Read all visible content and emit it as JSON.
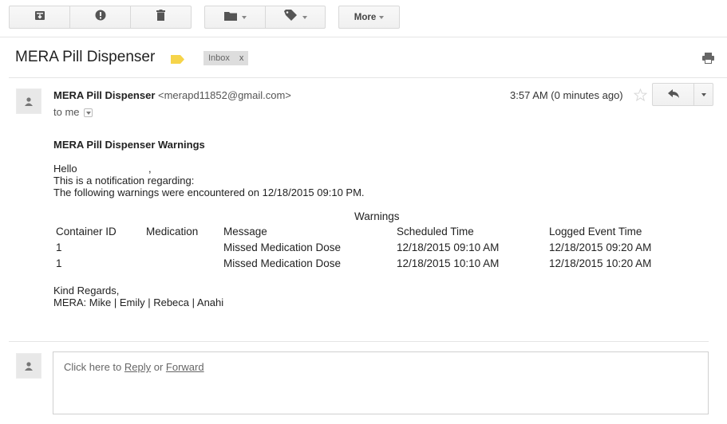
{
  "toolbar": {
    "more_label": "More",
    "icons": [
      "archive-icon",
      "spam-icon",
      "trash-icon",
      "folder-icon",
      "label-icon"
    ]
  },
  "subject": {
    "title": "MERA Pill Dispenser",
    "label_chip": "Inbox",
    "label_chip_close": "x"
  },
  "message": {
    "sender_name": "MERA Pill Dispenser",
    "sender_email": "<merapd11852@gmail.com>",
    "to_line": "to me",
    "time": "3:57 AM (0 minutes ago)",
    "heading": "MERA Pill Dispenser Warnings",
    "greeting": "Hello",
    "greeting_comma": ",",
    "line1": "This is a notification regarding:",
    "line2": "The following warnings were encountered on 12/18/2015 09:10 PM.",
    "table_title": "Warnings",
    "columns": [
      "Container ID",
      "Medication",
      "Message",
      "Scheduled Time",
      "Logged Event Time"
    ],
    "rows": [
      [
        "1",
        "",
        "Missed Medication Dose",
        "12/18/2015 09:10 AM",
        "12/18/2015 09:20 AM"
      ],
      [
        "1",
        "",
        "Missed Medication Dose",
        "12/18/2015 10:10 AM",
        "12/18/2015 10:20 AM"
      ]
    ],
    "closing": "Kind Regards,",
    "signature": "MERA: Mike | Emily | Rebeca | Anahi"
  },
  "reply": {
    "prefix": "Click here to ",
    "reply_link": "Reply",
    "middle": " or ",
    "forward_link": "Forward"
  },
  "colors": {
    "label_chip_bg": "#dddddd",
    "important_marker": "#f6d44a",
    "link": "#666666"
  }
}
